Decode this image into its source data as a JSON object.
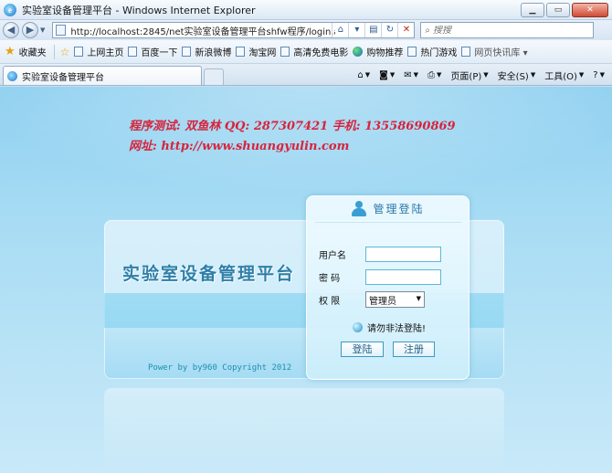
{
  "window": {
    "title": "实验室设备管理平台 - Windows Internet Explorer",
    "minimize": "▁",
    "maximize": "▭",
    "close": "✕"
  },
  "address_bar": {
    "url": "http://localhost:2845/net实验室设备管理平台shfw程序/login.aspx",
    "search_placeholder": "搜搜"
  },
  "favorites_bar": {
    "favorites_label": "收藏夹",
    "items": [
      "上网主页",
      "百度一下",
      "新浪微博",
      "淘宝网",
      "高清免费电影",
      "购物推荐",
      "热门游戏",
      "网页快讯库 ▾"
    ]
  },
  "tabs": [
    {
      "label": "实验室设备管理平台"
    }
  ],
  "command_bar": {
    "page": "页面(P)",
    "safety": "安全(S)",
    "tools": "工具(O)",
    "help": "?"
  },
  "page": {
    "credit_line1": "程序测试: 双鱼林    QQ: 287307421    手机: 13558690869",
    "credit_line2": "网址: http://www.shuangyulin.com",
    "system_title": "实验室设备管理平台",
    "copyright": "Power by by960 Copyright 2012"
  },
  "login": {
    "header": "管理登陆",
    "username_label": "用户名",
    "password_label": "密  码",
    "role_label": "权  限",
    "role_selected": "管理员",
    "notice": "请勿非法登陆!",
    "login_button": "登陆",
    "register_button": "注册"
  },
  "colors": {
    "credit_text": "#d8233c",
    "page_background": "#a8dcf4",
    "title_text": "#2d7fa8"
  }
}
